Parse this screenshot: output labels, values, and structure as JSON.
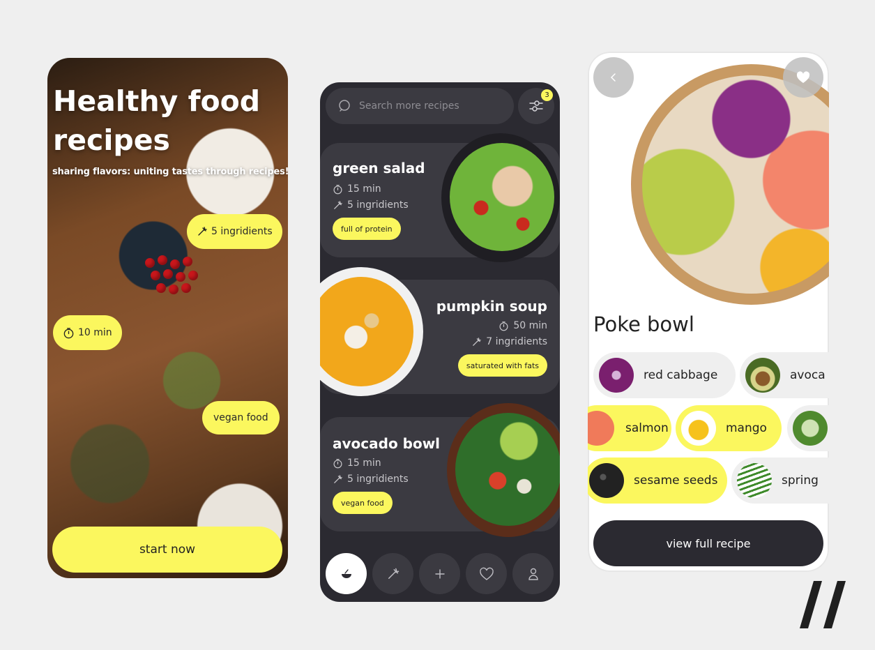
{
  "colors": {
    "accent": "#fbf75e",
    "dark": "#2b2a31",
    "card": "#3b3a41"
  },
  "intro": {
    "title_line1": "Healthy food",
    "title_line2": "recipes",
    "subtitle": "sharing flavors: uniting tastes through recipes!",
    "chips": {
      "ingredients": "5 ingridients",
      "time": "10 min",
      "vegan": "vegan food"
    },
    "cta_label": "start now"
  },
  "list": {
    "search_placeholder": "Search more recipes",
    "filter_count": "3",
    "recipes": [
      {
        "title": "green salad",
        "time": "15 min",
        "ingredients": "5 ingridients",
        "tag": "full of  protein"
      },
      {
        "title": "pumpkin soup",
        "time": "50 min",
        "ingredients": "7 ingridients",
        "tag": "saturated with fats"
      },
      {
        "title": "avocado bowl",
        "time": "15 min",
        "ingredients": "5 ingridients",
        "tag": "vegan food"
      }
    ],
    "nav": [
      {
        "icon": "bowl-icon"
      },
      {
        "icon": "carrot-icon"
      },
      {
        "icon": "plus-icon"
      },
      {
        "icon": "heart-icon"
      },
      {
        "icon": "user-icon"
      }
    ]
  },
  "detail": {
    "title": "Poke bowl",
    "ingredients": [
      {
        "label": "red cabbage",
        "selected": false
      },
      {
        "label": "avoca",
        "selected": false
      },
      {
        "label": "salmon",
        "selected": true
      },
      {
        "label": "mango",
        "selected": true
      },
      {
        "label": "sesame seeds",
        "selected": true
      },
      {
        "label": "spring",
        "selected": false
      }
    ],
    "cta_label": "view full recipe"
  }
}
